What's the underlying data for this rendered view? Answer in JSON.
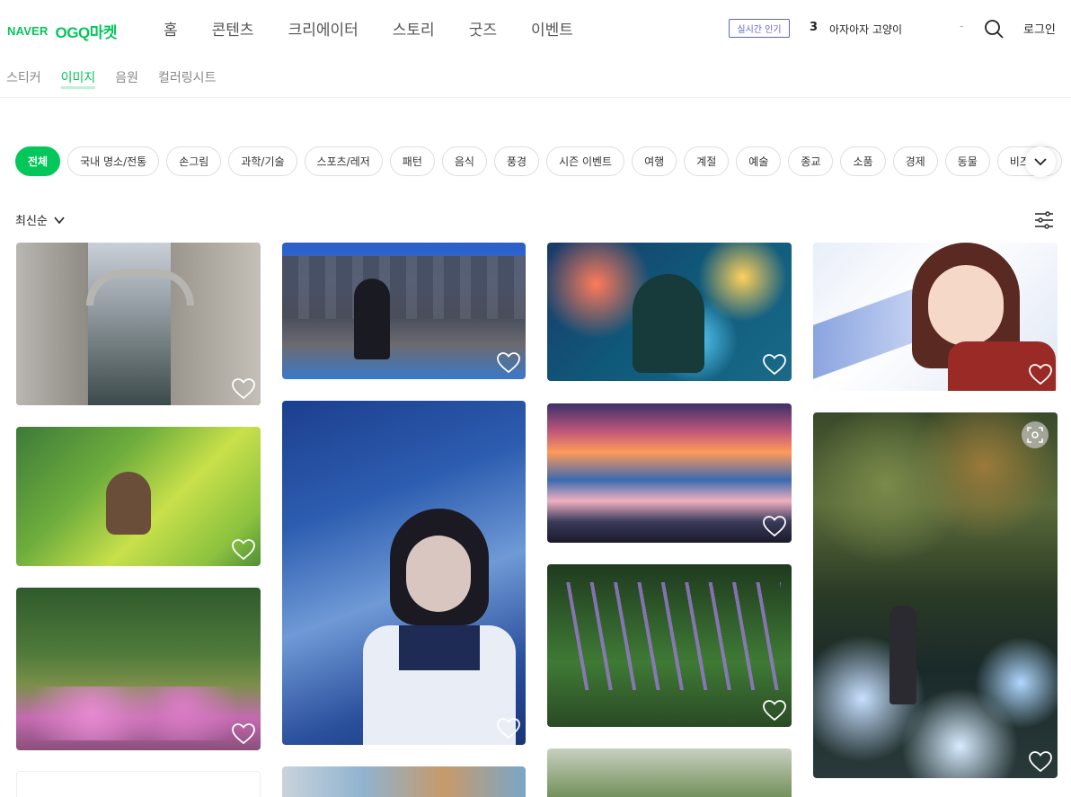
{
  "header": {
    "logo_naver": "NAVER",
    "logo_ogq": "OGQ마켓",
    "nav": [
      "홈",
      "콘텐츠",
      "크리에이터",
      "스토리",
      "굿즈",
      "이벤트"
    ],
    "live_badge": "실시간 인기",
    "rank_number": "3",
    "rank_text": "아자아자 고양이",
    "rank_dash": "-",
    "login": "로그인"
  },
  "subnav": {
    "items": [
      "스티커",
      "이미지",
      "음원",
      "컬러링시트"
    ],
    "active_index": 1
  },
  "categories": [
    "전체",
    "국내 명소/전통",
    "손그림",
    "과학/기술",
    "스포츠/레저",
    "패턴",
    "음식",
    "풍경",
    "시즌 이벤트",
    "여행",
    "계절",
    "예술",
    "종교",
    "소품",
    "경제",
    "동물",
    "비즈니스"
  ],
  "active_category": "전체",
  "sort_label": "최신순",
  "icons": {
    "search": "search-icon",
    "filter": "filter-sliders-icon",
    "heart": "heart-icon",
    "chevron": "chevron-down-icon",
    "lens": "lens-search-icon"
  },
  "colors": {
    "accent": "#03c75a",
    "badge": "#5b64d6"
  }
}
